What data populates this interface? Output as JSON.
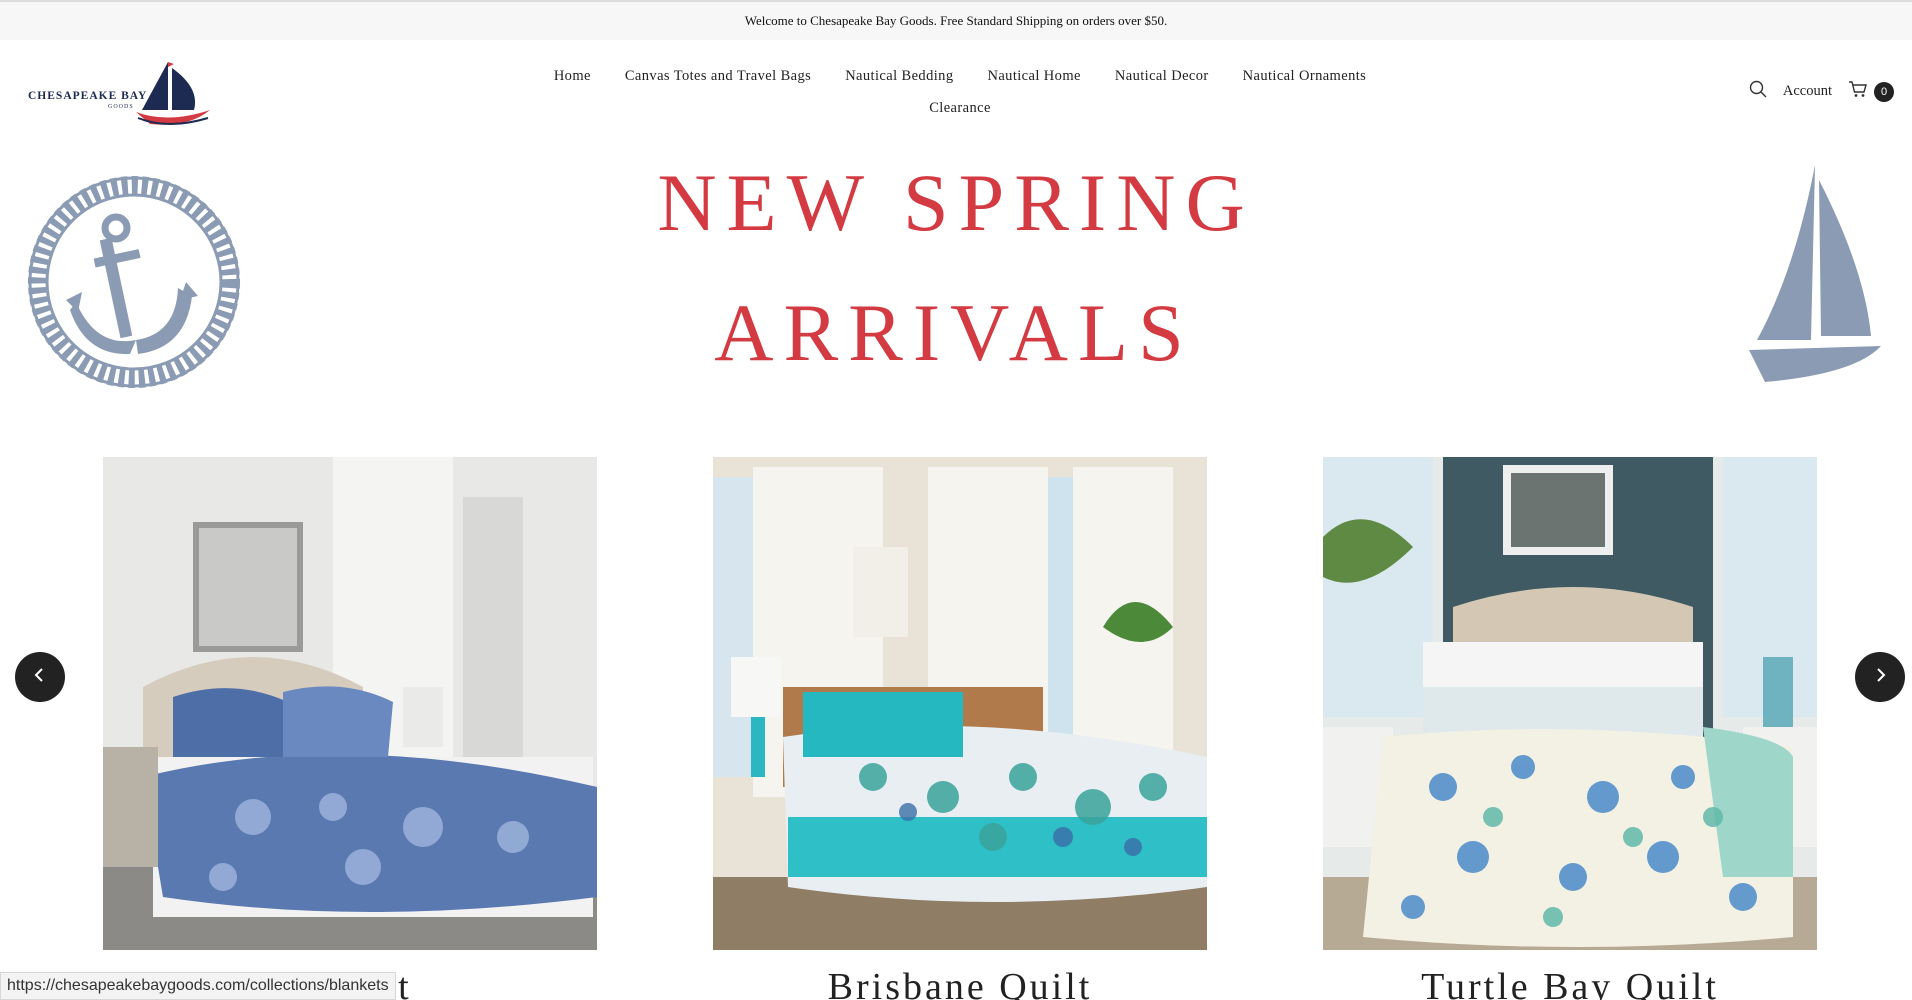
{
  "announcement": "Welcome to Chesapeake Bay Goods. Free Standard Shipping on orders over $50.",
  "brand": {
    "name": "CHESAPEAKE BAY",
    "sub": "GOODS"
  },
  "nav": {
    "row1": [
      "Home",
      "Canvas Totes and Travel Bags",
      "Nautical Bedding",
      "Nautical Home",
      "Nautical Decor",
      "Nautical Ornaments"
    ],
    "row2": [
      "Clearance"
    ]
  },
  "utility": {
    "account_label": "Account",
    "cart_count": "0",
    "icons": [
      "search-icon",
      "cart-icon"
    ]
  },
  "hero": {
    "line1": "NEW SPRING",
    "line2": "ARRIVALS"
  },
  "carousel": {
    "products": [
      {
        "title": "Seashore Quilt",
        "visible_title": "s Quilt"
      },
      {
        "title": "Brisbane Quilt",
        "visible_title": "Brisbane Quilt"
      },
      {
        "title": "Turtle Bay Quilt",
        "visible_title": "Turtle Bay Quilt"
      }
    ],
    "prev_icon": "chevron-left-icon",
    "next_icon": "chevron-right-icon"
  },
  "status_url": "https://chesapeakebaygoods.com/collections/blankets",
  "colors": {
    "accent_red": "#d33a41",
    "navy": "#1d2a52",
    "slate": "#8a9bb3"
  }
}
